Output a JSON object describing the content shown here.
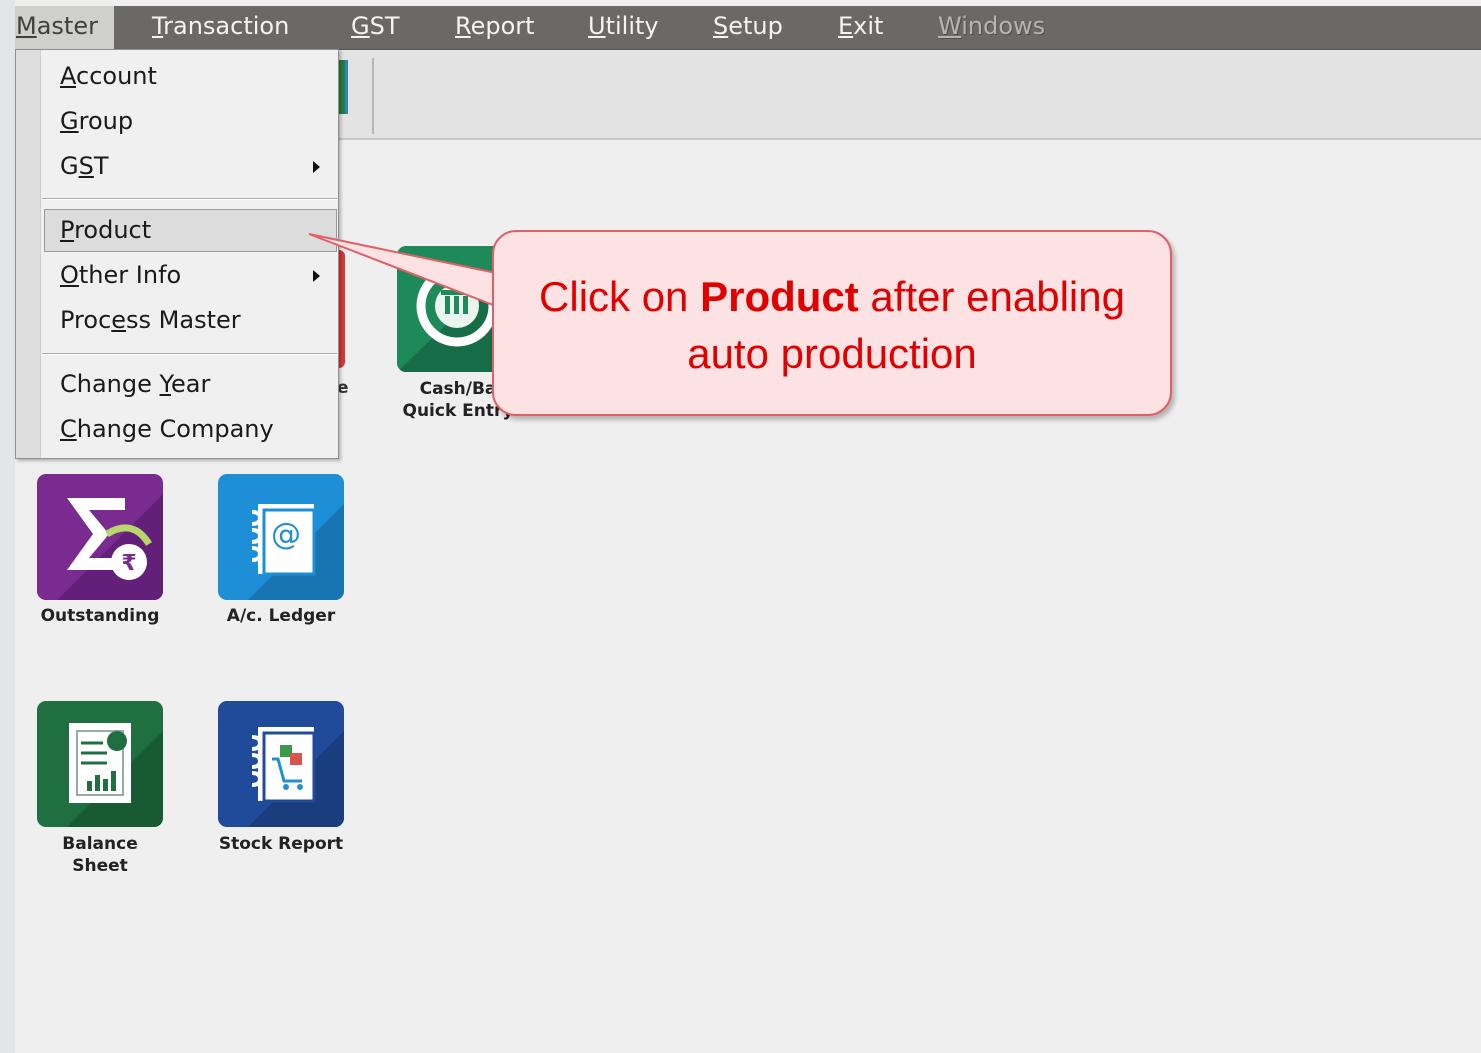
{
  "menubar": {
    "items": [
      {
        "pre": "",
        "mnemonic": "M",
        "post": "aster"
      },
      {
        "pre": "",
        "mnemonic": "T",
        "post": "ransaction"
      },
      {
        "pre": "",
        "mnemonic": "G",
        "post": "ST"
      },
      {
        "pre": "",
        "mnemonic": "R",
        "post": "eport"
      },
      {
        "pre": "",
        "mnemonic": "U",
        "post": "tility"
      },
      {
        "pre": "",
        "mnemonic": "S",
        "post": "etup"
      },
      {
        "pre": "",
        "mnemonic": "E",
        "post": "xit"
      },
      {
        "pre": "",
        "mnemonic": "W",
        "post": "indows"
      }
    ]
  },
  "master_menu": {
    "items": [
      {
        "pre": "",
        "mnemonic": "A",
        "post": "ccount"
      },
      {
        "pre": "",
        "mnemonic": "G",
        "post": "roup"
      },
      {
        "pre": "G",
        "mnemonic": "S",
        "post": "T"
      },
      {
        "pre": "",
        "mnemonic": "P",
        "post": "roduct"
      },
      {
        "pre": "",
        "mnemonic": "O",
        "post": "ther Info"
      },
      {
        "pre": "Proc",
        "mnemonic": "e",
        "post": "ss Master"
      },
      {
        "pre": "Change ",
        "mnemonic": "Y",
        "post": "ear"
      },
      {
        "pre": "",
        "mnemonic": "C",
        "post": "hange Company"
      }
    ]
  },
  "tiles": {
    "cash_bank": "Cash/Ba\nQuick Entry",
    "outstanding": "Outstanding",
    "ac_ledger": "A/c. Ledger",
    "balance_sheet": "Balance\nSheet",
    "stock_report": "Stock Report",
    "hidden_tile_fragment": "e"
  },
  "callout": {
    "before": "Click on ",
    "bold": "Product",
    "after": " after enabling auto production"
  },
  "colors": {
    "menubar": "#6a6966",
    "callout_fill": "#fde2e4",
    "callout_border": "#e06068",
    "callout_text": "#e00000",
    "outstanding_tile": "#7a2b8f",
    "ledger_tile": "#1e8fd6",
    "balance_tile": "#1f6f40",
    "stock_tile": "#1f4b9a",
    "cash_tile": "#1e8a5a"
  }
}
